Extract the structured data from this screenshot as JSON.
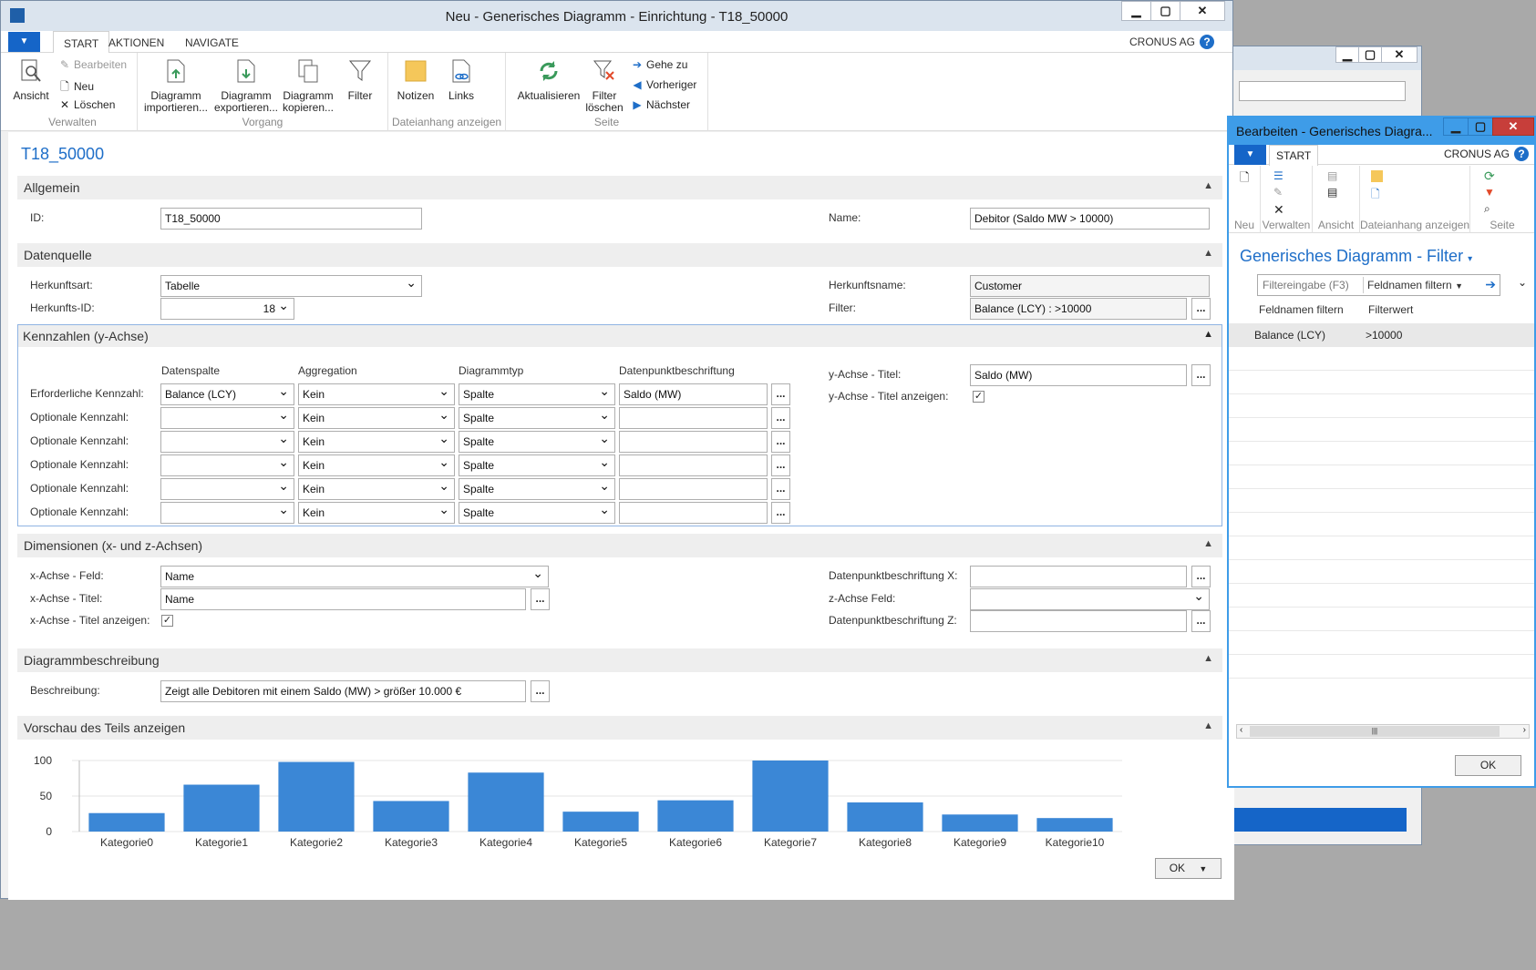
{
  "main_window": {
    "title": "Neu - Generisches Diagramm - Einrichtung - T18_50000",
    "minimize": "▁",
    "maximize": "▢",
    "close": "✕",
    "tabs": [
      "START",
      "AKTIONEN",
      "NAVIGATE"
    ],
    "company": "CRONUS AG",
    "help": "?"
  },
  "ribbon": {
    "verwalten": {
      "label": "Verwalten",
      "ansicht": "Ansicht",
      "bearbeiten": "Bearbeiten",
      "neu": "Neu",
      "loeschen": "Löschen"
    },
    "vorgang": {
      "label": "Vorgang",
      "import": [
        "Diagramm",
        "importieren..."
      ],
      "export": [
        "Diagramm",
        "exportieren..."
      ],
      "copy": [
        "Diagramm",
        "kopieren..."
      ],
      "filter": "Filter"
    },
    "dateianhang": {
      "label": "Dateianhang anzeigen",
      "notizen": "Notizen",
      "links": "Links"
    },
    "seite": {
      "label": "Seite",
      "aktualisieren": "Aktualisieren",
      "filter_loeschen": [
        "Filter",
        "löschen"
      ],
      "gehe_zu": "Gehe zu",
      "vorheriger": "Vorheriger",
      "naechster": "Nächster"
    }
  },
  "page_title": "T18_50000",
  "allgemein": {
    "header": "Allgemein",
    "id_label": "ID:",
    "id_value": "T18_50000",
    "name_label": "Name:",
    "name_value": "Debitor (Saldo MW > 10000)"
  },
  "datenquelle": {
    "header": "Datenquelle",
    "herkunftsart_label": "Herkunftsart:",
    "herkunftsart_value": "Tabelle",
    "herkunfts_id_label": "Herkunfts-ID:",
    "herkunfts_id_value": "18",
    "herkunftsname_label": "Herkunftsname:",
    "herkunftsname_value": "Customer",
    "filter_label": "Filter:",
    "filter_value": "Balance (LCY) : >10000"
  },
  "kennzahlen": {
    "header": "Kennzahlen (y-Achse)",
    "col_datenspalte": "Datenspalte",
    "col_aggregation": "Aggregation",
    "col_diagrammtyp": "Diagrammtyp",
    "col_beschriftung": "Datenpunktbeschriftung",
    "rows": [
      {
        "label": "Erforderliche Kennzahl:",
        "datenspalte": "Balance (LCY)",
        "aggregation": "Kein",
        "typ": "Spalte",
        "beschriftung": "Saldo (MW)"
      },
      {
        "label": "Optionale Kennzahl:",
        "datenspalte": "",
        "aggregation": "Kein",
        "typ": "Spalte",
        "beschriftung": ""
      },
      {
        "label": "Optionale Kennzahl:",
        "datenspalte": "",
        "aggregation": "Kein",
        "typ": "Spalte",
        "beschriftung": ""
      },
      {
        "label": "Optionale Kennzahl:",
        "datenspalte": "",
        "aggregation": "Kein",
        "typ": "Spalte",
        "beschriftung": ""
      },
      {
        "label": "Optionale Kennzahl:",
        "datenspalte": "",
        "aggregation": "Kein",
        "typ": "Spalte",
        "beschriftung": ""
      },
      {
        "label": "Optionale Kennzahl:",
        "datenspalte": "",
        "aggregation": "Kein",
        "typ": "Spalte",
        "beschriftung": ""
      }
    ],
    "y_titel_label": "y-Achse - Titel:",
    "y_titel_value": "Saldo (MW)",
    "y_titel_anzeigen_label": "y-Achse - Titel anzeigen:"
  },
  "dimensionen": {
    "header": "Dimensionen (x- und z-Achsen)",
    "x_feld_label": "x-Achse - Feld:",
    "x_feld_value": "Name",
    "x_titel_label": "x-Achse - Titel:",
    "x_titel_value": "Name",
    "x_titel_anzeigen_label": "x-Achse - Titel anzeigen:",
    "dp_x_label": "Datenpunktbeschriftung X:",
    "z_feld_label": "z-Achse Feld:",
    "dp_z_label": "Datenpunktbeschriftung Z:"
  },
  "beschreibung": {
    "header": "Diagrammbeschreibung",
    "label": "Beschreibung:",
    "value": "Zeigt alle Debitoren mit einem Saldo (MW) > größer 10.000 €"
  },
  "vorschau": {
    "header": "Vorschau des Teils anzeigen"
  },
  "chart_data": {
    "type": "bar",
    "categories": [
      "Kategorie0",
      "Kategorie1",
      "Kategorie2",
      "Kategorie3",
      "Kategorie4",
      "Kategorie5",
      "Kategorie6",
      "Kategorie7",
      "Kategorie8",
      "Kategorie9",
      "Kategorie10"
    ],
    "values": [
      26,
      66,
      98,
      43,
      83,
      28,
      44,
      100,
      41,
      24,
      19
    ],
    "yticks": [
      "0",
      "50",
      "100"
    ],
    "ylim": [
      0,
      100
    ],
    "color": "#3b87d6"
  },
  "ok_label": "OK",
  "ellipsis": "...",
  "check": "✓",
  "filter_window": {
    "title": "Bearbeiten - Generisches Diagra...",
    "tab": "START",
    "company": "CRONUS AG",
    "ribbon_labels": [
      "Neu",
      "Verwalten",
      "Ansicht",
      "Dateianhang anzeigen",
      "Seite"
    ],
    "heading": "Generisches Diagramm - Filter",
    "filter_placeholder": "Filtereingabe (F3)",
    "filter_field": "Feldnamen filtern",
    "col_feld": "Feldnamen filtern",
    "col_wert": "Filterwert",
    "rows": [
      {
        "feld": "Balance (LCY)",
        "wert": ">10000"
      }
    ],
    "scroll_thumb": "|||",
    "ok": "OK"
  }
}
